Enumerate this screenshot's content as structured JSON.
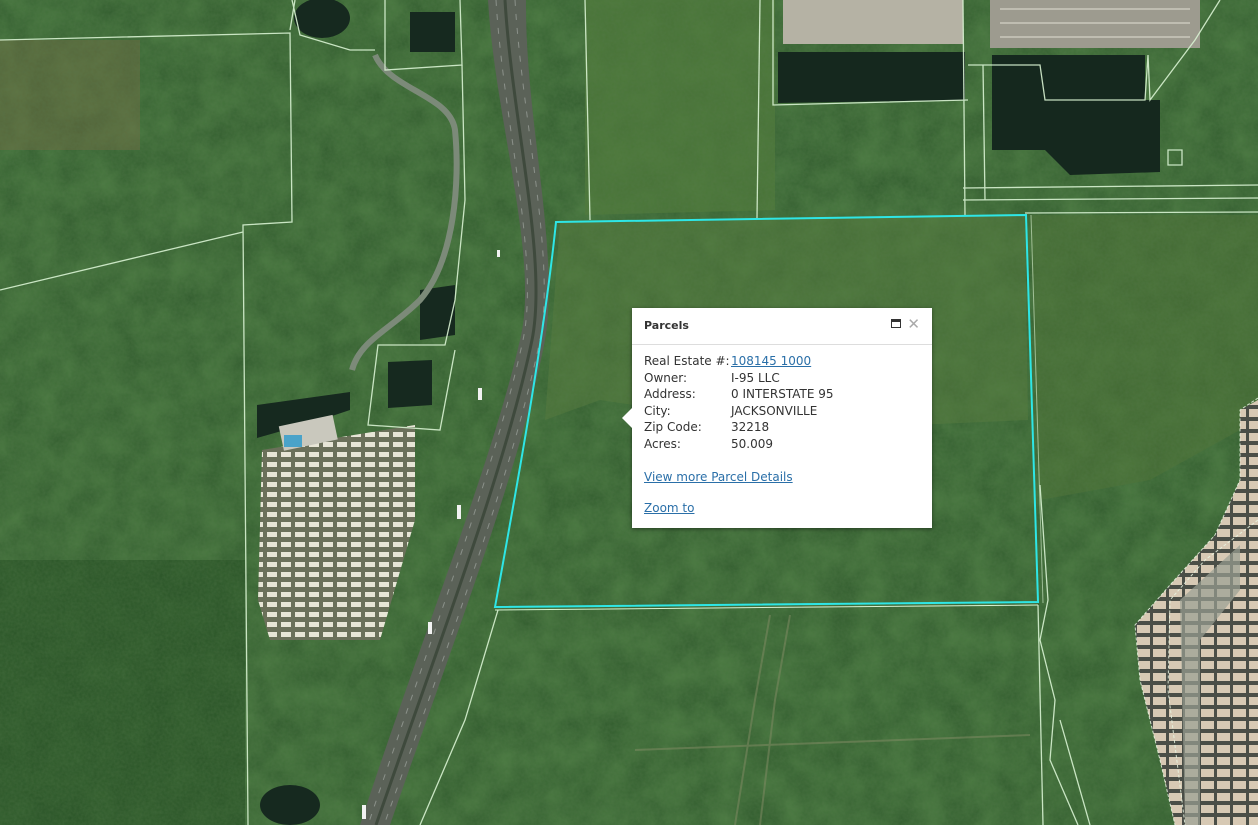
{
  "popup": {
    "title": "Parcels",
    "maximize_icon": "maximize-icon",
    "close_icon": "close-icon",
    "close_glyph": "✕",
    "fields": [
      {
        "label": "Real Estate #:",
        "value": "108145 1000",
        "link": true
      },
      {
        "label": "Owner:",
        "value": "I-95 LLC",
        "link": false
      },
      {
        "label": "Address:",
        "value": "0 INTERSTATE 95",
        "link": false
      },
      {
        "label": "City:",
        "value": "JACKSONVILLE",
        "link": false
      },
      {
        "label": "Zip Code:",
        "value": "32218",
        "link": false
      },
      {
        "label": "Acres:",
        "value": "50.009",
        "link": false
      }
    ],
    "view_more_label": "View more Parcel Details",
    "zoom_label": "Zoom to"
  },
  "map": {
    "selected_parcel_color": "#2ee6e6",
    "parcel_line_color": "#d8f2d2",
    "vegetation_color": "#2f5a2c"
  }
}
